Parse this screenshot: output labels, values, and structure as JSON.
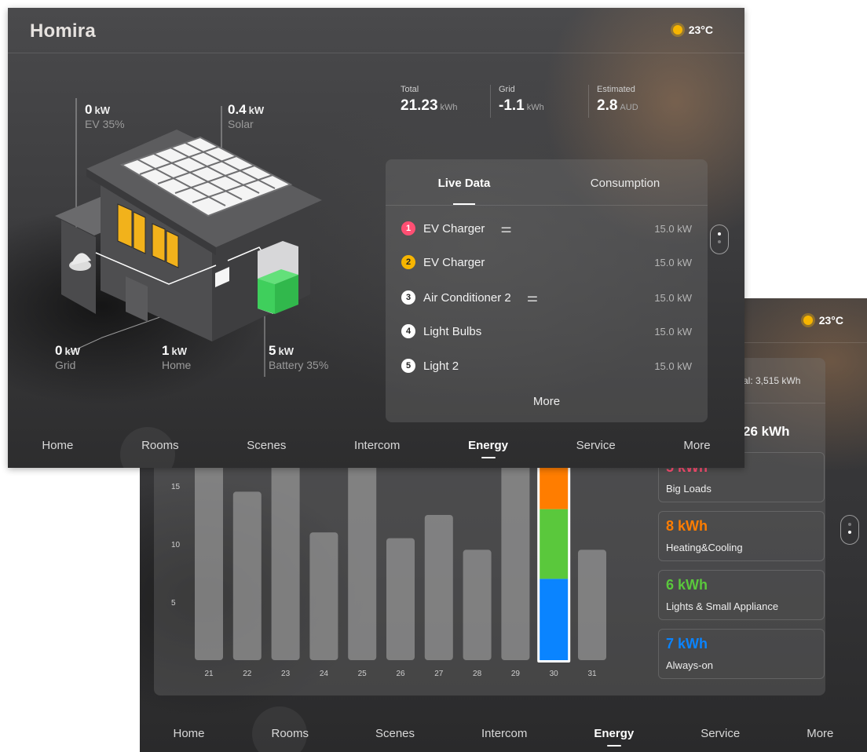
{
  "back": {
    "weather": {
      "temp": "23°C",
      "icon": "sun-icon"
    },
    "total_partial": "al: 3,515 kWh",
    "big_value_partial": "26 kWh",
    "chart_data": {
      "type": "bar",
      "categories": [
        "21",
        "22",
        "23",
        "24",
        "25",
        "26",
        "27",
        "28",
        "29",
        "30",
        "31"
      ],
      "values": [
        17.5,
        14.5,
        18.5,
        11,
        19,
        10.5,
        12.5,
        9.5,
        17.5,
        26,
        9.5
      ],
      "stacked_day": {
        "category": "30",
        "segments": [
          {
            "name": "Always-on",
            "value": 7,
            "color": "#0a84ff"
          },
          {
            "name": "Lights & Small Appliance",
            "value": 6,
            "color": "#5ac83c"
          },
          {
            "name": "Heating&Cooling",
            "value": 8,
            "color": "#ff7d00"
          },
          {
            "name": "Big Loads",
            "value": 5,
            "color": "#ff4f73"
          }
        ]
      },
      "yticks": [
        "5",
        "10",
        "15"
      ],
      "ylim": [
        0,
        20
      ]
    },
    "cards": [
      {
        "value": "5 kWh",
        "label": "Big Loads",
        "color": "#ff4f73"
      },
      {
        "value": "8 kWh",
        "label": "Heating&Cooling",
        "color": "#ff7d00"
      },
      {
        "value": "6 kWh",
        "label": "Lights & Small Appliance",
        "color": "#5ac83c"
      },
      {
        "value": "7 kWh",
        "label": "Always-on",
        "color": "#0a84ff"
      }
    ],
    "nav": [
      "Home",
      "Rooms",
      "Scenes",
      "Intercom",
      "Energy",
      "Service",
      "More"
    ],
    "nav_active": "Energy"
  },
  "front": {
    "logo": "Homira",
    "weather": {
      "temp": "23°C",
      "icon": "sun-icon"
    },
    "stats": [
      {
        "label": "Total",
        "value": "21.23",
        "unit": "kWh"
      },
      {
        "label": "Grid",
        "value": "-1.1",
        "unit": "kWh"
      },
      {
        "label": "Estimated",
        "value": "2.8",
        "unit": "AUD"
      }
    ],
    "house": {
      "ev": {
        "value": "0",
        "unit": "kW",
        "sub": "EV 35%"
      },
      "solar": {
        "value": "0.4",
        "unit": "kW",
        "sub": "Solar"
      },
      "grid": {
        "value": "0",
        "unit": "kW",
        "sub": "Grid"
      },
      "home": {
        "value": "1",
        "unit": "kW",
        "sub": "Home"
      },
      "battery": {
        "value": "5",
        "unit": "kW",
        "sub": "Battery 35%"
      }
    },
    "tabs": [
      "Live Data",
      "Consumption"
    ],
    "active_tab": "Live Data",
    "devices": [
      {
        "num": "1",
        "name": "EV Charger",
        "power": "15.0 kW",
        "badge_color": "#ff4f73",
        "has_settings": true
      },
      {
        "num": "2",
        "name": "EV Charger",
        "power": "15.0 kW",
        "badge_color": "#f7b500",
        "has_settings": false
      },
      {
        "num": "3",
        "name": "Air Conditioner 2",
        "power": "15.0 kW",
        "badge_color": "#ffffff",
        "has_settings": true
      },
      {
        "num": "4",
        "name": "Light Bulbs",
        "power": "15.0 kW",
        "badge_color": "#ffffff",
        "has_settings": false
      },
      {
        "num": "5",
        "name": "Light 2",
        "power": "15.0 kW",
        "badge_color": "#ffffff",
        "has_settings": false
      }
    ],
    "more_label": "More",
    "nav": [
      "Home",
      "Rooms",
      "Scenes",
      "Intercom",
      "Energy",
      "Service",
      "More"
    ],
    "nav_active": "Energy"
  }
}
